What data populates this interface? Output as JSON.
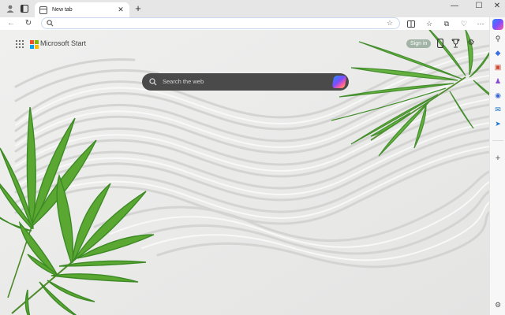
{
  "browser": {
    "tab": {
      "title": "New tab"
    },
    "address": {
      "value": "",
      "placeholder": ""
    }
  },
  "page": {
    "brand": "Microsoft Start",
    "signin_label": "Sign in",
    "search": {
      "placeholder": "Search the web"
    }
  },
  "icons": {
    "tabstrip": [
      "profile-icon",
      "tab-actions-icon",
      "new-tab-favicon",
      "close-tab-icon",
      "new-tab-plus-icon"
    ],
    "window": [
      "minimize-icon",
      "maximize-icon",
      "close-window-icon"
    ],
    "toolbar": [
      "back-icon",
      "refresh-icon",
      "search-icon",
      "favorite-star-icon",
      "split-screen-icon",
      "favorites-icon",
      "collections-icon",
      "browser-essentials-icon",
      "more-icon",
      "copilot-icon"
    ],
    "sidebar": [
      "search-icon",
      "shopping-icon",
      "tools-icon",
      "games-icon",
      "microsoft-365-icon",
      "outlook-icon",
      "drop-icon",
      "add-icon",
      "settings-icon"
    ],
    "page": [
      "apps-grid-icon",
      "microsoft-logo-icon",
      "phone-icon",
      "rewards-trophy-icon",
      "settings-gear-icon",
      "copilot-icon"
    ]
  },
  "colors": {
    "tabstrip_bg": "#e6e6e6",
    "searchbox_bg": "#4a4a4a",
    "palm_green": "#4a9a2c",
    "sand": "#ececec"
  }
}
